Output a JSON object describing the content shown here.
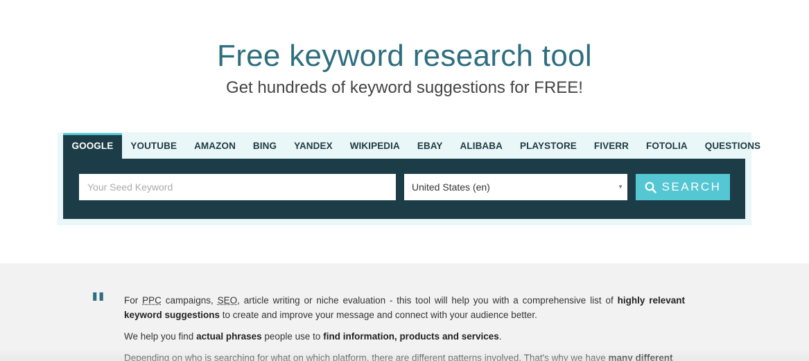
{
  "hero": {
    "title": "Free keyword research tool",
    "subtitle": "Get hundreds of keyword suggestions for FREE!"
  },
  "tabs": [
    {
      "label": "GOOGLE",
      "active": true
    },
    {
      "label": "YOUTUBE",
      "active": false
    },
    {
      "label": "AMAZON",
      "active": false
    },
    {
      "label": "BING",
      "active": false
    },
    {
      "label": "YANDEX",
      "active": false
    },
    {
      "label": "WIKIPEDIA",
      "active": false
    },
    {
      "label": "EBAY",
      "active": false
    },
    {
      "label": "ALIBABA",
      "active": false
    },
    {
      "label": "PLAYSTORE",
      "active": false
    },
    {
      "label": "FIVERR",
      "active": false
    },
    {
      "label": "FOTOLIA",
      "active": false
    },
    {
      "label": "QUESTIONS",
      "active": false
    }
  ],
  "search": {
    "placeholder": "Your Seed Keyword",
    "value": "",
    "country": "United States (en)",
    "button_label": "SEARCH",
    "button_icon": "search-icon"
  },
  "content": {
    "quote_mark": "\"",
    "p1": {
      "t1": "For ",
      "ppc": "PPC",
      "t2": " campaigns, ",
      "seo": "SEO",
      "t3": ", article writing or niche evaluation - this tool will help you with a comprehensive list of ",
      "b1": "highly relevant keyword suggestions",
      "t4": " to create and improve your message and connect with your audience better."
    },
    "p2": {
      "t1": "We help you find ",
      "b1": "actual phrases",
      "t2": " people use to ",
      "b2": "find information, products and services",
      "t3": "."
    },
    "p3": {
      "t1": "Depending on who is searching for what on which platform, there are different patterns involved. That's why we have ",
      "b1": "many different"
    }
  },
  "colors": {
    "title": "#2e6e7e",
    "panel": "#1c3d47",
    "tab_strip": "#eaf7f9",
    "accent": "#54c7d3",
    "lower_bg": "#f2f2f2"
  }
}
